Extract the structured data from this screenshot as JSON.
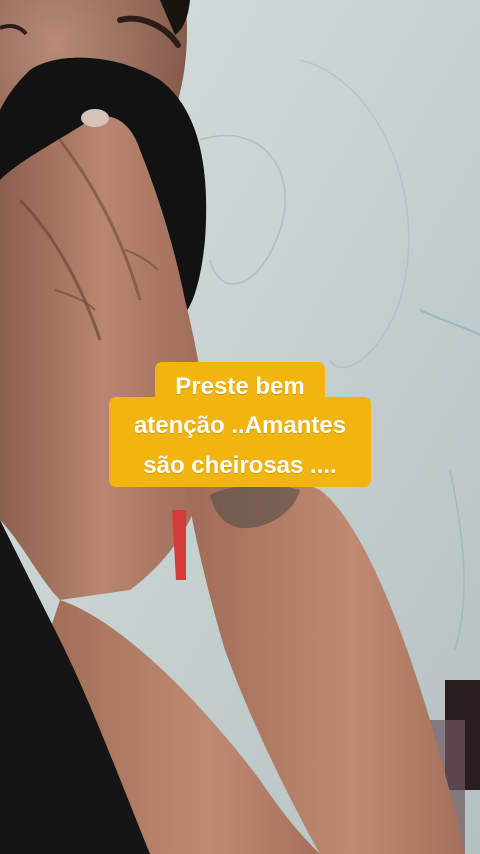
{
  "caption": {
    "lines": [
      "Preste bem",
      "atenção ..Amantes",
      "são cheirosas ...."
    ],
    "background_color": "#F2B40F",
    "text_color": "#FFFFFF"
  },
  "scene": {
    "subject": "video-frame",
    "wall_color": "#C9D3D3",
    "cloth_color": "#111111",
    "skin_color": "#B07E68"
  }
}
